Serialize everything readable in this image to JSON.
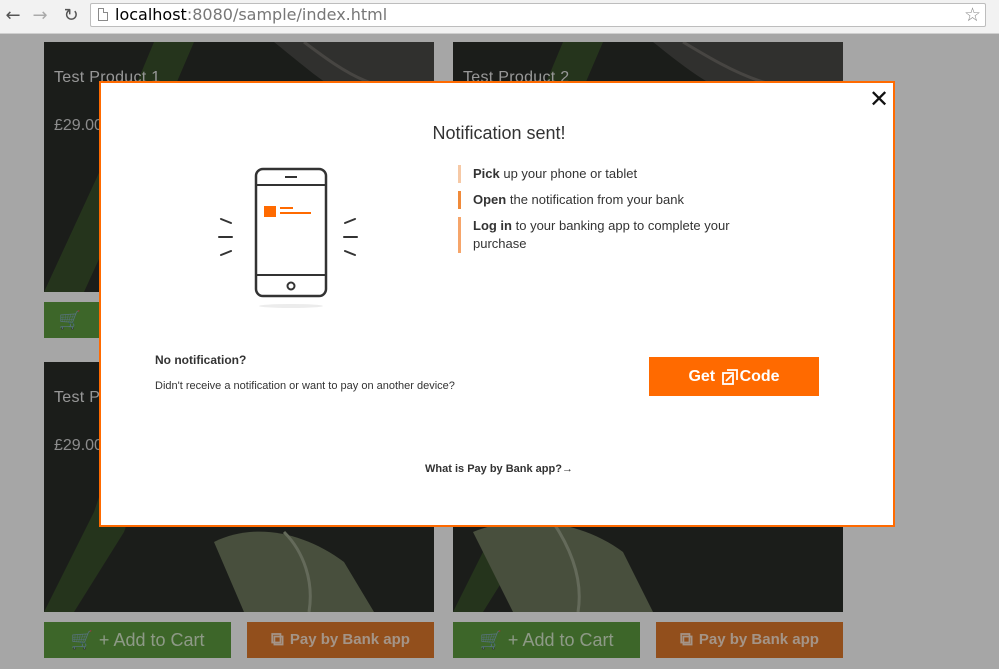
{
  "browser": {
    "url_host": "localhost",
    "url_rest": ":8080/sample/index.html"
  },
  "products": [
    {
      "title": "Test Product 1",
      "price": "£29.00"
    },
    {
      "title": "Test Product 2",
      "price": ""
    },
    {
      "title": "Test P",
      "price": "£29.00"
    },
    {
      "title": "",
      "price": ""
    }
  ],
  "buttons": {
    "add_to_cart": "Add to Cart",
    "pay_by_bank": "Pay by Bank app"
  },
  "modal": {
    "title": "Notification sent!",
    "steps": [
      {
        "strong": "Pick",
        "rest": " up your phone or tablet"
      },
      {
        "strong": "Open",
        "rest": " the notification from your bank"
      },
      {
        "strong": "Log in",
        "rest": " to your banking app to complete your purchase"
      }
    ],
    "no_notification_heading": "No notification?",
    "no_notification_text": "Didn't receive a notification or want to pay on another device?",
    "get_code_before": "Get",
    "get_code_after": "Code",
    "what_is_link": "What is Pay by Bank app?",
    "what_is_arrow": "→"
  },
  "colors": {
    "accent": "#ff6a00",
    "cart_green": "#5f9d3f",
    "pay_orange": "#e07a2c"
  },
  "icons": {
    "back": "arrow-left-icon",
    "forward": "arrow-right-icon",
    "reload": "reload-icon",
    "bookmark": "star-icon",
    "cart": "cart-icon",
    "close": "close-icon",
    "pay_by_bank": "pay-by-bank-icon",
    "phone": "phone-icon"
  }
}
